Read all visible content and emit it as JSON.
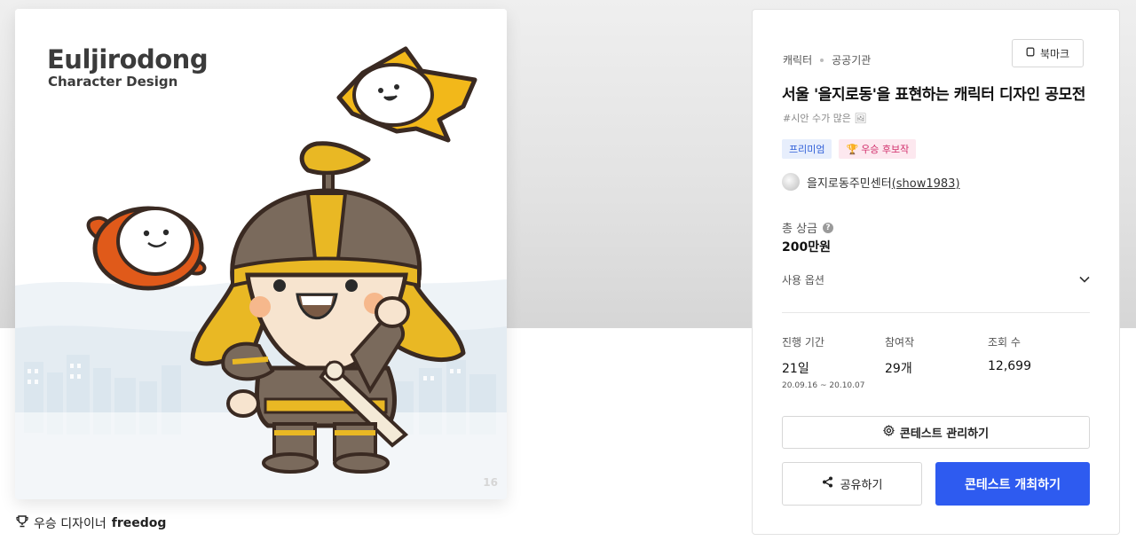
{
  "artwork": {
    "title": "Euljirodong",
    "subtitle": "Character Design",
    "page_number": "16"
  },
  "winner": {
    "label": "우승 디자이너",
    "name": "freedog"
  },
  "contest": {
    "category": "캐릭터",
    "organizer_type": "공공기관",
    "bookmark_label": "북마크",
    "title": "서울 '을지로동'을 표현하는 캐릭터 디자인 공모전",
    "hashtag": "#시안 수가 많은 🖼",
    "tags": {
      "premium": "프리미엄",
      "award": "우승 후보작"
    },
    "organizer": {
      "name": "을지로동주민센터",
      "handle": "(show1983)"
    },
    "prize_label": "총 상금",
    "prize_value": "200만원",
    "options_label": "사용 옵션",
    "stats": {
      "period_label": "진행 기간",
      "period_value": "21일",
      "period_start": "20.09.16",
      "period_separator": "~",
      "period_end": "20.10.07",
      "entries_label": "참여작",
      "entries_value": "29개",
      "views_label": "조회 수",
      "views_value": "12,699"
    },
    "manage_label": "콘테스트 관리하기",
    "share_label": "공유하기",
    "host_label": "콘테스트 개최하기"
  },
  "colors": {
    "primary": "#2e5bf0",
    "premium_bg": "#e7eefc",
    "premium_text": "#2f5fd8",
    "award_bg": "#fde8ef",
    "award_text": "#d12f6c",
    "helmet_gold": "#e9b824",
    "armor_brown": "#7a6a5c"
  }
}
